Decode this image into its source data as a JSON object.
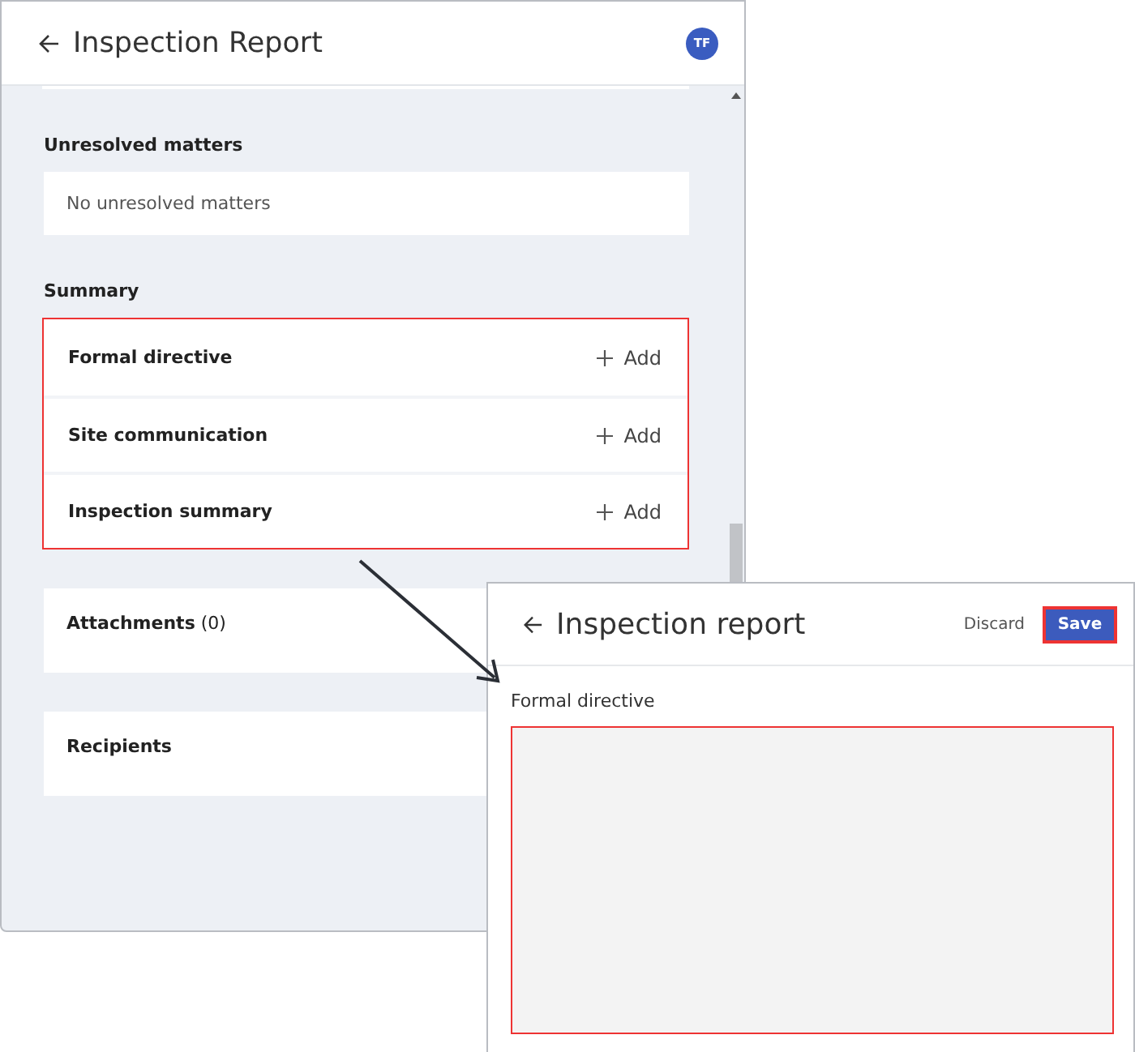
{
  "report": {
    "title": "Inspection Report",
    "avatar": "TF",
    "sections": [
      {
        "kind": "note",
        "heading": "Unresolved matters",
        "text": "No unresolved matters"
      },
      {
        "kind": "list",
        "heading": "Summary",
        "highlighted": true,
        "items": [
          {
            "label": "Formal directive",
            "action": "Add"
          },
          {
            "label": "Site communication",
            "action": "Add"
          },
          {
            "label": "Inspection summary",
            "action": "Add"
          }
        ]
      },
      {
        "kind": "card",
        "label": "**Attachments** (0)"
      },
      {
        "kind": "card",
        "label": "**Recipients**"
      }
    ]
  },
  "editor": {
    "title": "Inspection report",
    "discard": "Discard",
    "save": {
      "label": "Save",
      "highlighted": true
    },
    "field": {
      "label": "Formal directive",
      "highlighted": true
    }
  }
}
